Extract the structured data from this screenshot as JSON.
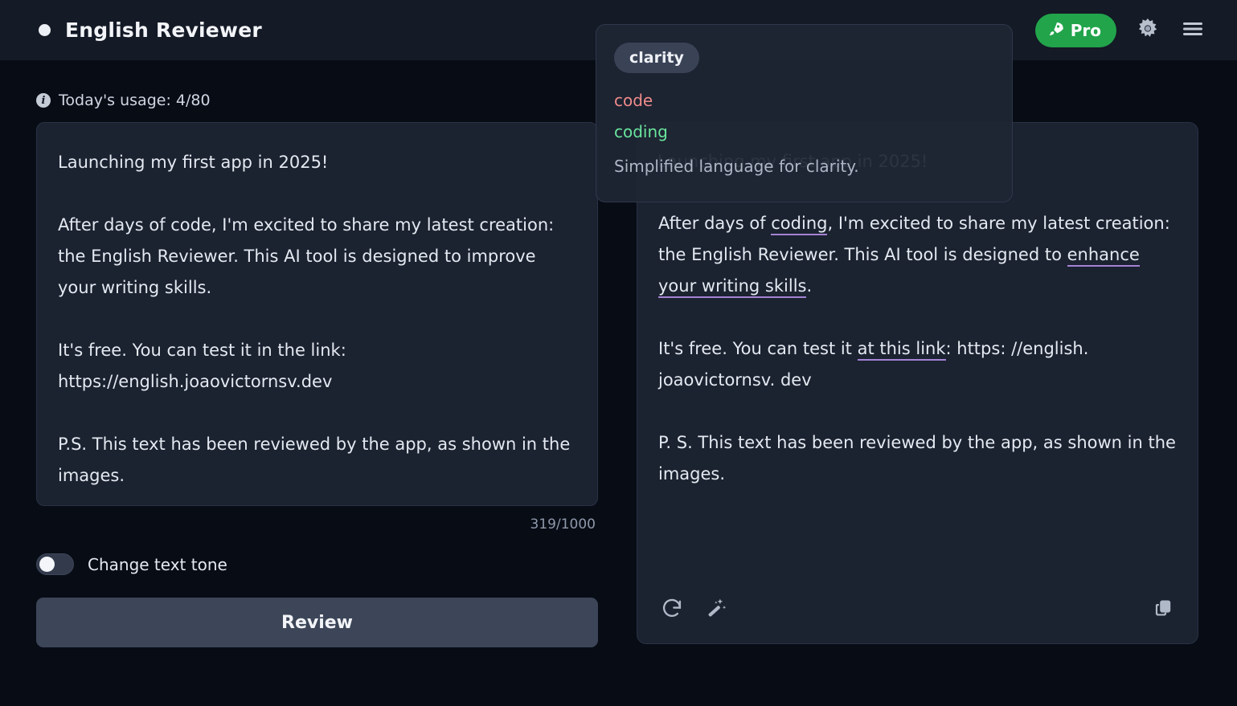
{
  "header": {
    "brand_dot": "status-dot",
    "title": "English Reviewer",
    "pro_label": "Pro",
    "pro_icon": "rocket-icon",
    "settings_icon": "gear-icon",
    "menu_icon": "hamburger-menu-icon",
    "accent_green": "#22a44b"
  },
  "usage": {
    "icon": "info-icon",
    "icon_glyph": "i",
    "text": "Today's usage: 4/80"
  },
  "editor": {
    "paragraphs": [
      "Launching my first app in 2025!",
      "After days of code, I'm excited to share my latest creation: the English Reviewer. This AI tool is designed to improve your writing skills.",
      "It's free. You can test it in the link: https://english.joaovictornsv.dev",
      "P.S. This text has been reviewed by the app, as shown in the images."
    ],
    "char_count": "319/1000"
  },
  "controls": {
    "tone_toggle_label": "Change text tone",
    "tone_toggle_state": "off",
    "review_label": "Review"
  },
  "output": {
    "ghost_heading": "Launching my first app in 2025!",
    "para2": {
      "pre": "After days of ",
      "hl1": "coding",
      "mid": ", I'm excited to share my latest creation: the English Reviewer. This AI tool is designed to ",
      "hl2": "enhance your writing skills",
      "post": "."
    },
    "para3": {
      "pre": "It's free. You can test it ",
      "hl1": "at this link",
      "post": ": https: //english. joaovictornsv. dev"
    },
    "para4": "P. S. This text has been reviewed by the app, as shown in the images.",
    "highlight_color": "#a483d4",
    "actions": {
      "regenerate_icon": "refresh-icon",
      "magic_icon": "magic-wand-icon",
      "copy_icon": "copy-icon"
    }
  },
  "tooltip": {
    "chip": "clarity",
    "old_word": "code",
    "new_word": "coding",
    "description": "Simplified language for clarity.",
    "old_color": "#ef8b8b",
    "new_color": "#69e59d"
  }
}
